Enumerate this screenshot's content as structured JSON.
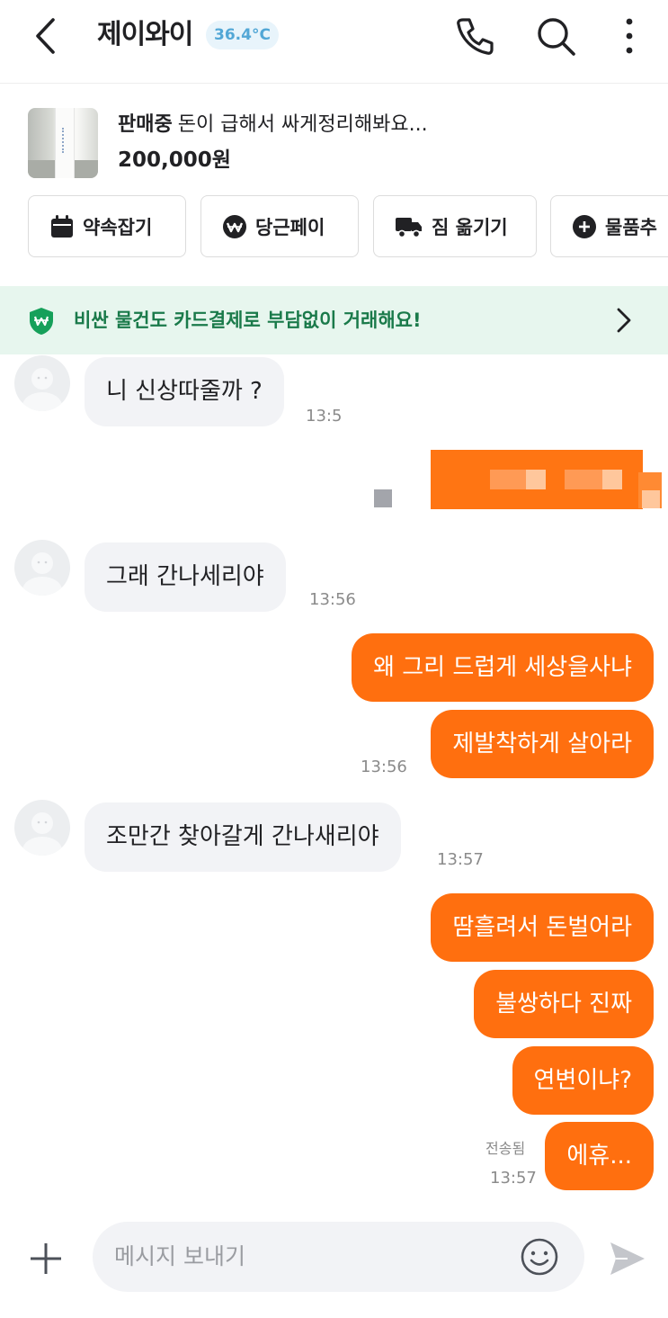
{
  "header": {
    "back_icon": "chevron-left-icon",
    "title": "제이와이",
    "temperature": "36.4°C",
    "icons": [
      "phone-icon",
      "search-icon",
      "more-vertical-icon"
    ]
  },
  "product": {
    "status": "판매중",
    "name": "돈이 급해서 싸게정리해봐요...",
    "price": "200,000원"
  },
  "actions": [
    {
      "label": "약속잡기",
      "icon": "calendar-icon"
    },
    {
      "label": "당근페이",
      "icon": "pay-won-icon"
    },
    {
      "label": "짐 옮기기",
      "icon": "truck-icon"
    },
    {
      "label": "물품추",
      "icon": "plus-circle-icon"
    }
  ],
  "banner": {
    "icon": "shield-won-icon",
    "text": "비싼 물건도 카드결제로 부담없이 거래해요!",
    "arrow": "chevron-right-icon"
  },
  "messages": {
    "m1": {
      "text": "니 신상따줄까 ?",
      "time": "13:5"
    },
    "m2": {
      "text": "그래 간나세리야",
      "time": "13:56"
    },
    "m3": {
      "text": "왜 그리 드럽게 세상을사냐"
    },
    "m4": {
      "text": "제발착하게 살아라",
      "time": "13:56"
    },
    "m5": {
      "text": "조만간 찾아갈게 간나새리야",
      "time": "13:57"
    },
    "m6": {
      "text": "땀흘려서 돈벌어라"
    },
    "m7": {
      "text": "불쌍하다 진짜"
    },
    "m8": {
      "text": "연변이냐?"
    },
    "m9": {
      "text": "에휴...",
      "status": "전송됨",
      "time": "13:57"
    }
  },
  "composer": {
    "placeholder": "메시지 보내기",
    "icons": [
      "plus-icon",
      "emoji-icon",
      "send-icon"
    ]
  },
  "colors": {
    "accent": "#ff6f0f",
    "incoming_bubble": "#f2f3f6",
    "banner_bg": "#e7f6ee",
    "banner_text": "#1a7a4a",
    "temperature": "#52a7d6"
  }
}
